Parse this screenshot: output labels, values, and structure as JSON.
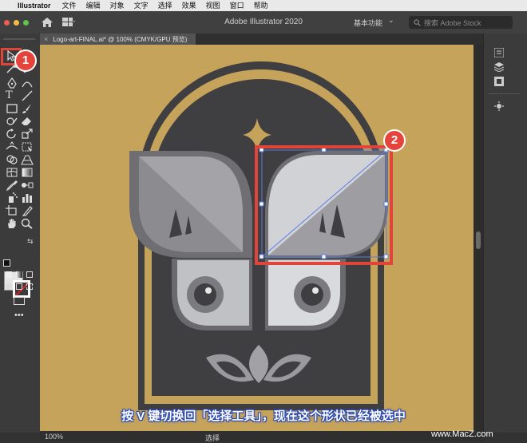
{
  "menubar": {
    "app_name": "Illustrator",
    "items": [
      "文件",
      "编辑",
      "对象",
      "文字",
      "选择",
      "效果",
      "视图",
      "窗口",
      "帮助"
    ]
  },
  "appbar": {
    "title": "Adobe Illustrator 2020",
    "workspace": "基本功能",
    "search_placeholder": "搜索 Adobe Stock"
  },
  "document": {
    "tab_label": "Logo-art-FINAL.ai* @ 100% (CMYK/GPU 预览)"
  },
  "status": {
    "zoom": "100%",
    "tool": "选择"
  },
  "annotations": {
    "badge1": "1",
    "badge2": "2",
    "caption": "按 V 键切换回「选择工具」，现在这个形状已经被选中",
    "watermark": "www.MacZ.com"
  },
  "colors": {
    "canvas": "#c6a35a",
    "artwork_dark": "#3f3e40",
    "highlight": "#e1453a",
    "selection": "#5a7be6"
  }
}
